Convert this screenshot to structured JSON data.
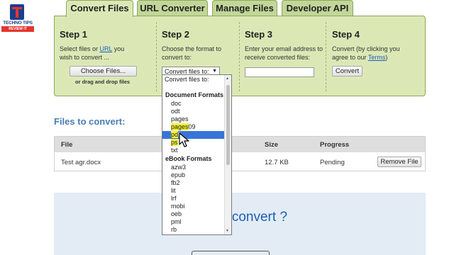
{
  "logo": {
    "name": "TECHNO TIPS",
    "sub": "REVIEW IT"
  },
  "tabs": [
    {
      "label": "Convert Files",
      "active": true
    },
    {
      "label": "URL Converter",
      "active": false
    },
    {
      "label": "Manage Files",
      "active": false
    },
    {
      "label": "Developer API",
      "active": false
    }
  ],
  "steps": {
    "step1": {
      "title": "Step 1",
      "text_before": "Select files or ",
      "link": "URL",
      "text_after": " you wish to convert ...",
      "button": "Choose Files...",
      "drag_text": "or drag and drop files"
    },
    "step2": {
      "title": "Step 2",
      "text": "Choose the format to convert to:",
      "select_value": "Convert files to:"
    },
    "step3": {
      "title": "Step 3",
      "text": "Enter your email address to receive converted files:",
      "email_value": ""
    },
    "step4": {
      "title": "Step 4",
      "text_before": "Convert (by clicking you agree to our ",
      "link": "Terms",
      "text_after": ")",
      "button": "Convert"
    }
  },
  "files": {
    "title": "Files to convert:",
    "columns": [
      "File",
      "Size",
      "Progress"
    ],
    "rows": [
      {
        "file": "Test agr.docx",
        "size": "12.7 KB",
        "progress": "Pending",
        "action": "Remove File"
      }
    ]
  },
  "drop_zone": {
    "text_partial": "e ",
    "text_link": "convert ?"
  },
  "dropdown": {
    "header": "Convert files to:",
    "groups": [
      {
        "label": "Document Formats",
        "options": [
          {
            "label": "doc"
          },
          {
            "label": "odt"
          },
          {
            "label": "pages"
          },
          {
            "label": "pages09",
            "highlight": "pages"
          },
          {
            "label": "pdf",
            "highlight": "pd",
            "selected": true
          },
          {
            "label": "ps",
            "highlight": "ps"
          },
          {
            "label": "txt"
          }
        ]
      },
      {
        "label": "eBook Formats",
        "options": [
          {
            "label": "azw3"
          },
          {
            "label": "epub"
          },
          {
            "label": "fb2"
          },
          {
            "label": "lit"
          },
          {
            "label": "lrf"
          },
          {
            "label": "mobi"
          },
          {
            "label": "oeb"
          },
          {
            "label": "pml"
          },
          {
            "label": "rb"
          }
        ]
      }
    ]
  },
  "colors": {
    "panel_bg": "#dbe8b6",
    "tab_bg": "#c3d699",
    "accent_blue": "#4a7eb3",
    "selection": "#3875d7",
    "highlight": "#f3f03a"
  }
}
